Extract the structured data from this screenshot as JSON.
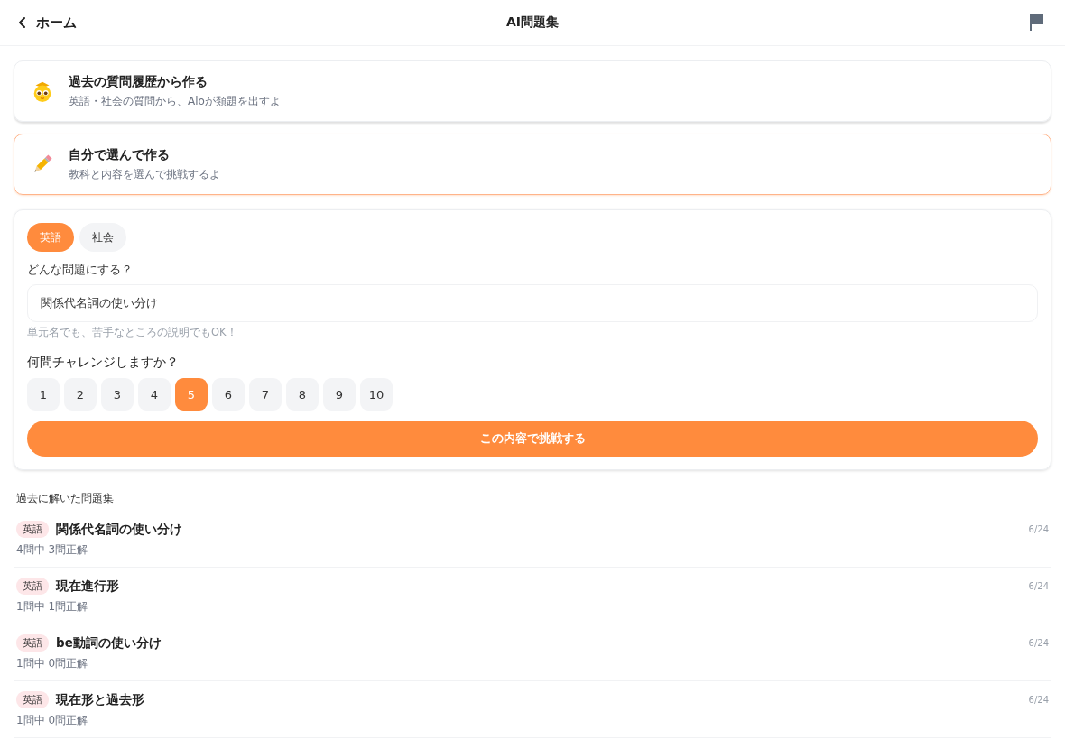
{
  "header": {
    "back_label": "ホーム",
    "title": "AI問題集"
  },
  "modes": [
    {
      "kind": "history",
      "title": "過去の質問履歴から作る",
      "subtitle": "英語・社会の質問から、Aloが類題を出すよ",
      "selected": false
    },
    {
      "kind": "manual",
      "title": "自分で選んで作る",
      "subtitle": "教科と内容を選んで挑戦するよ",
      "selected": true
    }
  ],
  "form": {
    "subjects": [
      {
        "label": "英語",
        "selected": true
      },
      {
        "label": "社会",
        "selected": false
      }
    ],
    "topic_label": "どんな問題にする？",
    "topic_value": "関係代名詞の使い分け",
    "hint": "単元名でも、苦手なところの説明でもOK！",
    "count_label": "何問チャレンジしますか？",
    "counts": [
      {
        "label": "1",
        "selected": false
      },
      {
        "label": "2",
        "selected": false
      },
      {
        "label": "3",
        "selected": false
      },
      {
        "label": "4",
        "selected": false
      },
      {
        "label": "5",
        "selected": true
      },
      {
        "label": "6",
        "selected": false
      },
      {
        "label": "7",
        "selected": false
      },
      {
        "label": "8",
        "selected": false
      },
      {
        "label": "9",
        "selected": false
      },
      {
        "label": "10",
        "selected": false
      }
    ],
    "submit": "この内容で挑戦する"
  },
  "history": {
    "heading": "過去に解いた問題集",
    "items": [
      {
        "subject": "英語",
        "title": "関係代名詞の使い分け",
        "score": "4問中 3問正解",
        "date": "6/24"
      },
      {
        "subject": "英語",
        "title": "現在進行形",
        "score": "1問中 1問正解",
        "date": "6/24"
      },
      {
        "subject": "英語",
        "title": "be動詞の使い分け",
        "score": "1問中 0問正解",
        "date": "6/24"
      },
      {
        "subject": "英語",
        "title": "現在形と過去形",
        "score": "1問中 0問正解",
        "date": "6/24"
      }
    ]
  }
}
